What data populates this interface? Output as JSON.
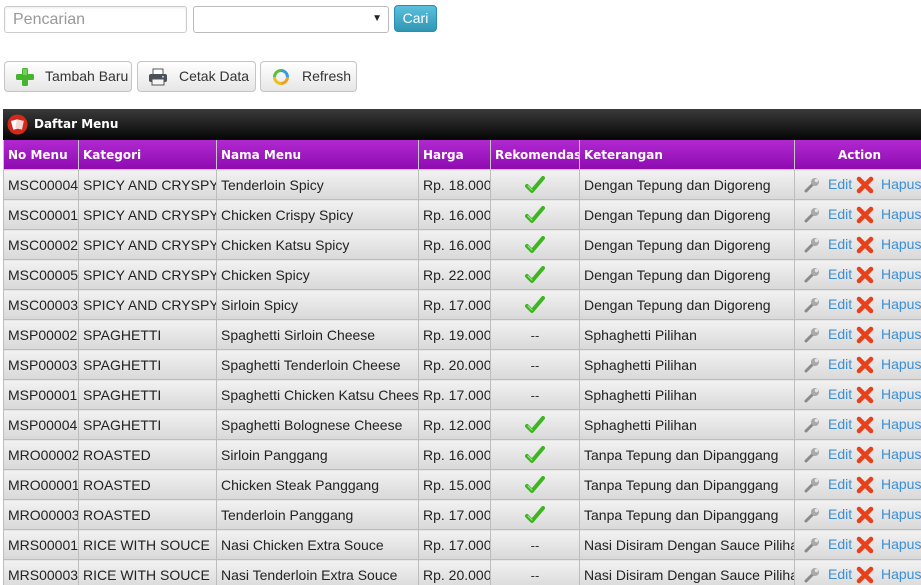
{
  "search": {
    "placeholder": "Pencarian",
    "value": ""
  },
  "category_select": {
    "selected": ""
  },
  "search_button": {
    "label": "Cari"
  },
  "toolbar": {
    "add_label": "Tambah Baru",
    "print_label": "Cetak Data",
    "refresh_label": "Refresh"
  },
  "panel": {
    "title": "Daftar Menu"
  },
  "table": {
    "headers": {
      "no_menu": "No Menu",
      "kategori": "Kategori",
      "nama_menu": "Nama Menu",
      "harga": "Harga",
      "rekomendasi": "Rekomendasi",
      "keterangan": "Keterangan",
      "action": "Action"
    },
    "action_labels": {
      "edit": "Edit",
      "delete": "Hapus"
    },
    "rows": [
      {
        "no": "MSC00004",
        "kategori": "SPICY AND CRYSPY",
        "nama": "Tenderloin Spicy",
        "harga": "Rp. 18.000",
        "rekomendasi": true,
        "keterangan": "Dengan Tepung dan Digoreng"
      },
      {
        "no": "MSC00001",
        "kategori": "SPICY AND CRYSPY",
        "nama": "Chicken Crispy Spicy",
        "harga": "Rp. 16.000",
        "rekomendasi": true,
        "keterangan": "Dengan Tepung dan Digoreng"
      },
      {
        "no": "MSC00002",
        "kategori": "SPICY AND CRYSPY",
        "nama": "Chicken Katsu Spicy",
        "harga": "Rp. 16.000",
        "rekomendasi": true,
        "keterangan": "Dengan Tepung dan Digoreng"
      },
      {
        "no": "MSC00005",
        "kategori": "SPICY AND CRYSPY",
        "nama": "Chicken Spicy",
        "harga": "Rp. 22.000",
        "rekomendasi": true,
        "keterangan": "Dengan Tepung dan Digoreng"
      },
      {
        "no": "MSC00003",
        "kategori": "SPICY AND CRYSPY",
        "nama": "Sirloin Spicy",
        "harga": "Rp. 17.000",
        "rekomendasi": true,
        "keterangan": "Dengan Tepung dan Digoreng"
      },
      {
        "no": "MSP00002",
        "kategori": "SPAGHETTI",
        "nama": "Spaghetti Sirloin Cheese",
        "harga": "Rp. 19.000",
        "rekomendasi": false,
        "keterangan": "Sphaghetti Pilihan"
      },
      {
        "no": "MSP00003",
        "kategori": "SPAGHETTI",
        "nama": "Spaghetti Tenderloin Cheese",
        "harga": "Rp. 20.000",
        "rekomendasi": false,
        "keterangan": "Sphaghetti Pilihan"
      },
      {
        "no": "MSP00001",
        "kategori": "SPAGHETTI",
        "nama": "Spaghetti Chicken Katsu Cheese",
        "harga": "Rp. 17.000",
        "rekomendasi": false,
        "keterangan": "Sphaghetti Pilihan"
      },
      {
        "no": "MSP00004",
        "kategori": "SPAGHETTI",
        "nama": "Spaghetti Bolognese Cheese",
        "harga": "Rp. 12.000",
        "rekomendasi": true,
        "keterangan": "Sphaghetti Pilihan"
      },
      {
        "no": "MRO00002",
        "kategori": "ROASTED",
        "nama": "Sirloin Panggang",
        "harga": "Rp. 16.000",
        "rekomendasi": true,
        "keterangan": "Tanpa Tepung dan Dipanggang"
      },
      {
        "no": "MRO00001",
        "kategori": "ROASTED",
        "nama": "Chicken Steak Panggang",
        "harga": "Rp. 15.000",
        "rekomendasi": true,
        "keterangan": "Tanpa Tepung dan Dipanggang"
      },
      {
        "no": "MRO00003",
        "kategori": "ROASTED",
        "nama": "Tenderloin Panggang",
        "harga": "Rp. 17.000",
        "rekomendasi": true,
        "keterangan": "Tanpa Tepung dan Dipanggang"
      },
      {
        "no": "MRS00001",
        "kategori": "RICE WITH SOUCE",
        "nama": "Nasi Chicken Extra Souce",
        "harga": "Rp. 17.000",
        "rekomendasi": false,
        "keterangan": "Nasi Disiram Dengan Sauce Pilihan"
      },
      {
        "no": "MRS00003",
        "kategori": "RICE WITH SOUCE",
        "nama": "Nasi Tenderloin Extra Souce",
        "harga": "Rp. 20.000",
        "rekomendasi": false,
        "keterangan": "Nasi Disiram Dengan Sauce Pilihan"
      }
    ],
    "not_recommended_mark": "--"
  },
  "icons": {
    "add": "plus-icon",
    "print": "printer-icon",
    "refresh": "refresh-icon",
    "panel": "menu-book-icon",
    "recommended": "check-icon",
    "edit": "wrench-icon",
    "delete": "x-icon"
  },
  "colors": {
    "header_purple": "#9b16c0",
    "panel_header": "#111111",
    "link": "#3a8fd6",
    "check_green": "#3cb521",
    "delete_red": "#e8401a",
    "search_button": "#49afcd"
  }
}
